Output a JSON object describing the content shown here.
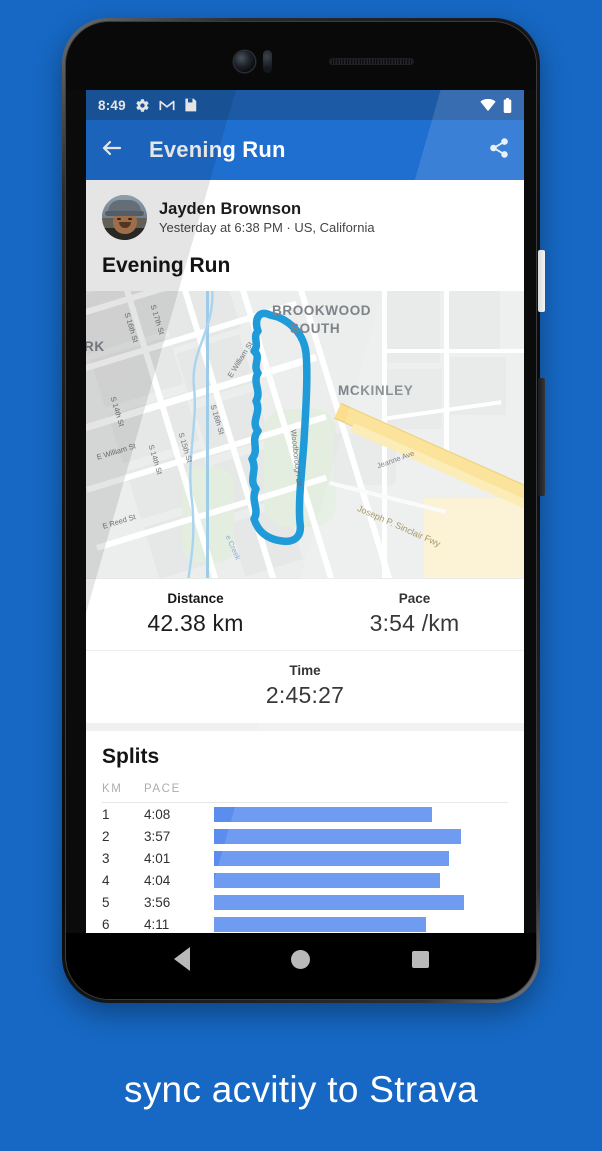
{
  "background_color": "#1668c4",
  "status_bar": {
    "time": "8:49",
    "icons_left": [
      "gear-icon",
      "gmail-icon",
      "save-icon"
    ],
    "icons_right": [
      "wifi-icon",
      "battery-icon"
    ],
    "background": "#1c5aa6"
  },
  "app_bar": {
    "back_icon": "arrow-left-icon",
    "title": "Evening Run",
    "share_icon": "share-icon",
    "background": "#1f6fd0"
  },
  "user": {
    "name": "Jayden Brownson",
    "meta": "Yesterday at 6:38 PM · US, California",
    "avatar": "profile-photo"
  },
  "activity": {
    "title": "Evening Run"
  },
  "map": {
    "neighborhoods": [
      "BROOKWOOD",
      "SOUTH",
      "MCKINLEY"
    ],
    "streets": [
      "S 17th St",
      "S 16th St",
      "S 16th St",
      "S 15th St",
      "S 14th St",
      "S 14th St",
      "E William St",
      "E William St",
      "E Reed St",
      "RK",
      "Woodborough Dr",
      "Jeanne Ave",
      "Joseph P. Sinclair Fwy",
      "e Creek"
    ],
    "route_color": "#1e9bd8"
  },
  "stats": {
    "distance_label": "Distance",
    "distance_value": "42.38 km",
    "pace_label": "Pace",
    "pace_value": "3:54 /km",
    "time_label": "Time",
    "time_value": "2:45:27"
  },
  "splits": {
    "title": "Splits",
    "header_km": "KM",
    "header_pace": "PACE",
    "bar_color": "#5b8def",
    "rows": [
      {
        "km": "1",
        "pace": "4:08",
        "bar_pct": 74
      },
      {
        "km": "2",
        "pace": "3:57",
        "bar_pct": 84
      },
      {
        "km": "3",
        "pace": "4:01",
        "bar_pct": 80
      },
      {
        "km": "4",
        "pace": "4:04",
        "bar_pct": 77
      },
      {
        "km": "5",
        "pace": "3:56",
        "bar_pct": 85
      },
      {
        "km": "6",
        "pace": "4:11",
        "bar_pct": 72
      }
    ]
  },
  "nav_bar": {
    "back": "nav-back-icon",
    "home": "nav-home-icon",
    "recents": "nav-recents-icon"
  },
  "caption": "sync acvitiy to Strava"
}
